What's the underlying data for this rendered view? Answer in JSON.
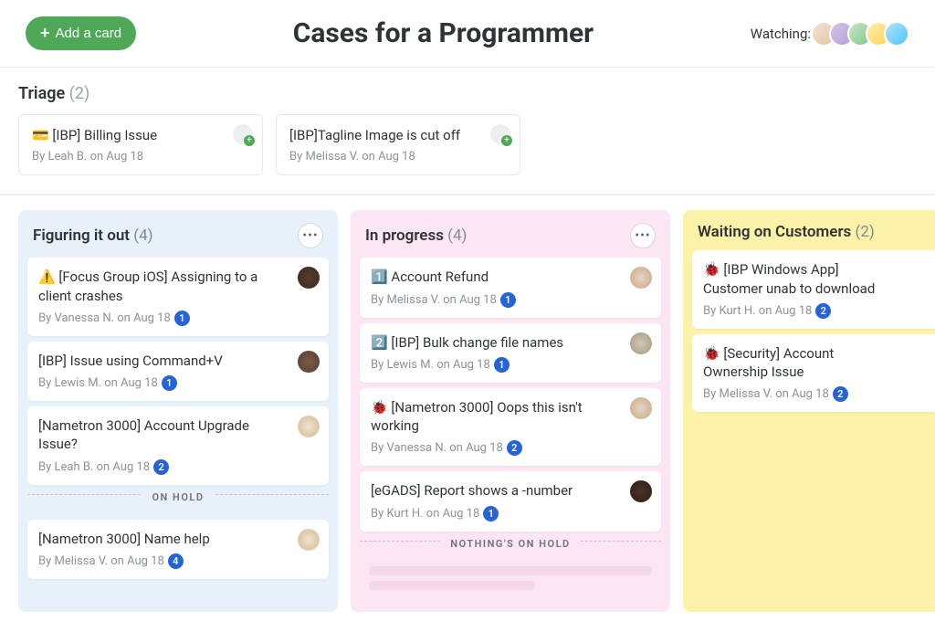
{
  "header": {
    "add_card_label": "Add a card",
    "title": "Cases for a Programmer",
    "watching_label": "Watching:"
  },
  "triage": {
    "title": "Triage",
    "count": "(2)",
    "cards": [
      {
        "icon": "💳",
        "title": "[IBP] Billing Issue",
        "meta": "By Leah B. on Aug 18"
      },
      {
        "icon": "",
        "title": "[IBP]Tagline Image is cut off",
        "meta": "By Melissa V. on Aug 18"
      }
    ]
  },
  "columns": [
    {
      "title": "Figuring it out",
      "count": "(4)",
      "color": "blue",
      "cards": [
        {
          "icon": "⚠️",
          "title": "[Focus Group iOS] Assigning to a client crashes",
          "meta": "By Vanessa N. on Aug 18",
          "badge": "1",
          "avatar": "av1"
        },
        {
          "icon": "",
          "title": "[IBP] Issue using Command+V",
          "meta": "By Lewis M. on Aug 18",
          "badge": "1",
          "avatar": "av2"
        },
        {
          "icon": "",
          "title": "[Nametron 3000] Account Upgrade Issue?",
          "meta": "By Leah B. on Aug 18",
          "badge": "2",
          "avatar": "av3"
        }
      ],
      "hold_label": "ON HOLD",
      "hold_cards": [
        {
          "icon": "",
          "title": "[Nametron 3000] Name help",
          "meta": "By Melissa V. on Aug 18",
          "badge": "4",
          "avatar": "av3"
        }
      ]
    },
    {
      "title": "In progress",
      "count": "(4)",
      "color": "pink",
      "cards": [
        {
          "icon": "1️⃣",
          "title": "Account Refund",
          "meta": "By Melissa V. on Aug 18",
          "badge": "1",
          "avatar": "av4"
        },
        {
          "icon": "2️⃣",
          "title": "[IBP] Bulk change file names",
          "meta": "By Lewis M. on Aug 18",
          "badge": "1",
          "avatar": "av5"
        },
        {
          "icon": "🐞",
          "title": "[Nametron 3000] Oops this isn't working",
          "meta": "By Vanessa N. on Aug 18",
          "badge": "2",
          "avatar": "av4"
        },
        {
          "icon": "",
          "title": "[eGADS] Report shows a -number",
          "meta": "By Kurt H. on Aug 18",
          "badge": "1",
          "avatar": "av6"
        }
      ],
      "hold_label": "NOTHING'S ON HOLD",
      "hold_cards": []
    },
    {
      "title": "Waiting on Customers",
      "count": "(2)",
      "color": "yellow",
      "cards": [
        {
          "icon": "🐞",
          "title": "[IBP Windows App] Customer unab to download",
          "meta": "By Kurt H. on Aug 18",
          "badge": "2",
          "avatar": ""
        },
        {
          "icon": "🐞",
          "title": "[Security] Account Ownership Issue",
          "meta": "By Melissa V. on Aug 18",
          "badge": "2",
          "avatar": ""
        }
      ],
      "hold_label": "",
      "hold_cards": []
    }
  ]
}
